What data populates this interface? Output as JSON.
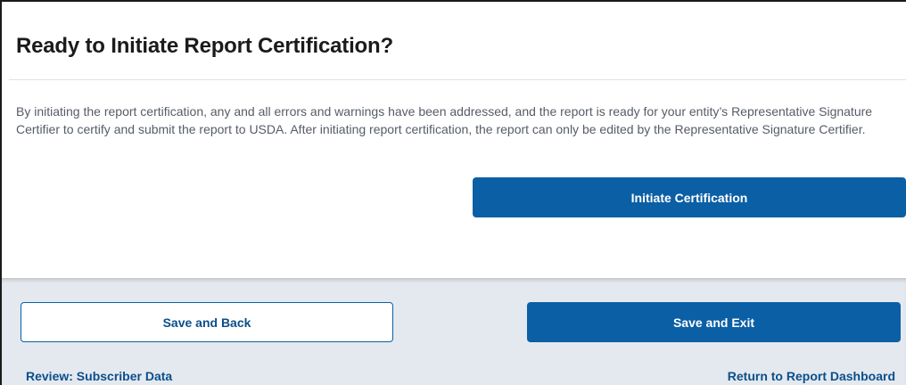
{
  "dialog": {
    "title": "Ready to Initiate Report Certification?",
    "description": "By initiating the report certification, any and all errors and warnings have been addressed, and the report is ready for your entity’s Representative Signature Certifier to certify and submit the report to USDA. After initiating report certification, the report can only be edited by the Representative Signature Certifier.",
    "initiate_label": "Initiate Certification"
  },
  "footer": {
    "save_back_label": "Save and Back",
    "save_exit_label": "Save and Exit",
    "prev_link_label": "Review: Subscriber Data",
    "dashboard_link_label": "Return to Report Dashboard"
  },
  "colors": {
    "primary": "#0b5fa5",
    "footer_bg": "#e4e9ef",
    "text": "#1b1b1b",
    "muted_text": "#565c65"
  }
}
